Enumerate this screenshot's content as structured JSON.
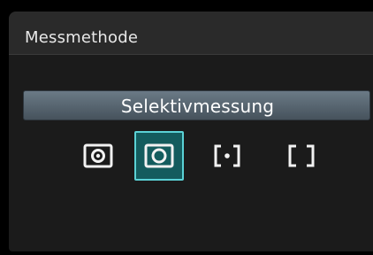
{
  "screen": {
    "title": "Messmethode"
  },
  "metering": {
    "selected_label": "Selektivmessung",
    "options": [
      {
        "icon": "evaluative-metering-icon",
        "selected": false
      },
      {
        "icon": "partial-metering-icon",
        "selected": true
      },
      {
        "icon": "spot-metering-icon",
        "selected": false
      },
      {
        "icon": "center-weighted-metering-icon",
        "selected": false
      }
    ]
  },
  "colors": {
    "selection_fill": "#145c5e",
    "selection_border": "#5bd2d6",
    "label_bar": "#5a6873",
    "panel": "#1b1b1b"
  }
}
